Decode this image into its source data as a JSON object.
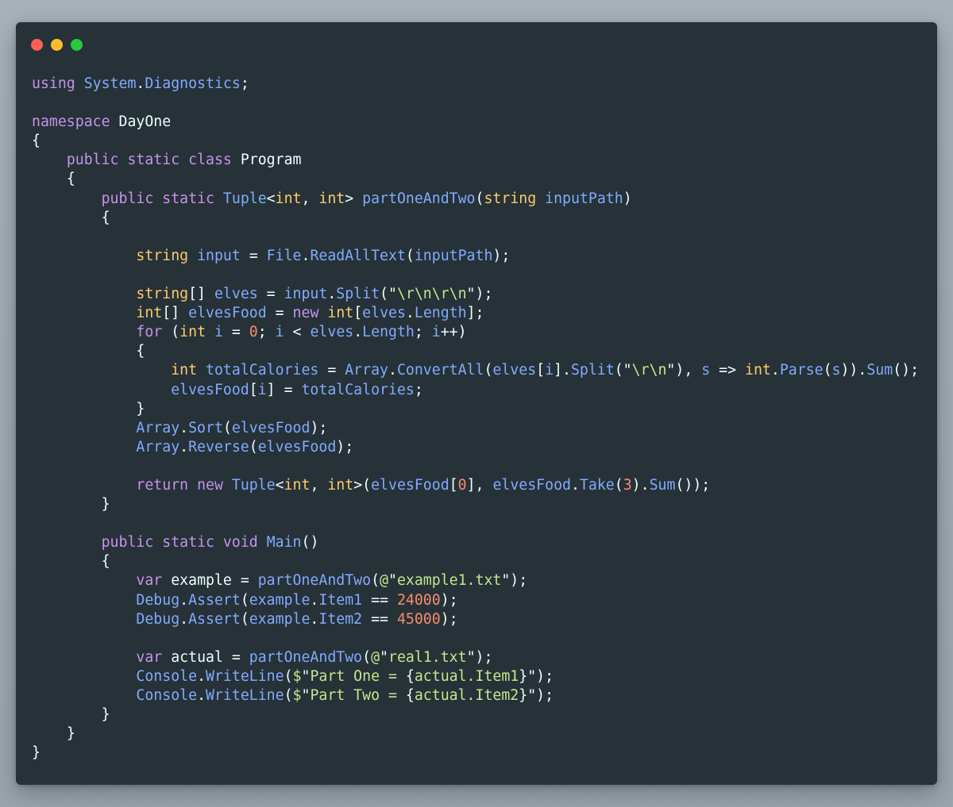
{
  "window": {
    "controls": {
      "close_color": "#ff5f56",
      "minimize_color": "#ffbd2e",
      "maximize_color": "#27c93f"
    }
  },
  "code": {
    "language": "csharp",
    "lines": [
      [
        [
          "kw",
          "using"
        ],
        [
          "plain",
          " "
        ],
        [
          "id",
          "System"
        ],
        [
          "punc",
          "."
        ],
        [
          "id",
          "Diagnostics"
        ],
        [
          "punc",
          ";"
        ]
      ],
      [],
      [
        [
          "kw",
          "namespace"
        ],
        [
          "plain",
          " DayOne"
        ]
      ],
      [
        [
          "punc",
          "{"
        ]
      ],
      [
        [
          "plain",
          "    "
        ],
        [
          "kw",
          "public"
        ],
        [
          "plain",
          " "
        ],
        [
          "kw",
          "static"
        ],
        [
          "plain",
          " "
        ],
        [
          "kw",
          "class"
        ],
        [
          "plain",
          " Program"
        ]
      ],
      [
        [
          "plain",
          "    "
        ],
        [
          "punc",
          "{"
        ]
      ],
      [
        [
          "plain",
          "        "
        ],
        [
          "kw",
          "public"
        ],
        [
          "plain",
          " "
        ],
        [
          "kw",
          "static"
        ],
        [
          "plain",
          " "
        ],
        [
          "id",
          "Tuple"
        ],
        [
          "punc",
          "<"
        ],
        [
          "type",
          "int"
        ],
        [
          "punc",
          ", "
        ],
        [
          "type",
          "int"
        ],
        [
          "punc",
          "> "
        ],
        [
          "fn",
          "partOneAndTwo"
        ],
        [
          "punc",
          "("
        ],
        [
          "type",
          "string"
        ],
        [
          "plain",
          " "
        ],
        [
          "id",
          "inputPath"
        ],
        [
          "punc",
          ")"
        ]
      ],
      [
        [
          "plain",
          "        "
        ],
        [
          "punc",
          "{"
        ]
      ],
      [],
      [
        [
          "plain",
          "            "
        ],
        [
          "type",
          "string"
        ],
        [
          "plain",
          " "
        ],
        [
          "id",
          "input"
        ],
        [
          "op",
          " = "
        ],
        [
          "id",
          "File"
        ],
        [
          "punc",
          "."
        ],
        [
          "fn",
          "ReadAllText"
        ],
        [
          "punc",
          "("
        ],
        [
          "id",
          "inputPath"
        ],
        [
          "punc",
          ");"
        ]
      ],
      [],
      [
        [
          "plain",
          "            "
        ],
        [
          "type",
          "string"
        ],
        [
          "punc",
          "[] "
        ],
        [
          "id",
          "elves"
        ],
        [
          "op",
          " = "
        ],
        [
          "id",
          "input"
        ],
        [
          "punc",
          "."
        ],
        [
          "fn",
          "Split"
        ],
        [
          "punc",
          "(\""
        ],
        [
          "str",
          "\\r\\n\\r\\n"
        ],
        [
          "punc",
          "\");"
        ]
      ],
      [
        [
          "plain",
          "            "
        ],
        [
          "type",
          "int"
        ],
        [
          "punc",
          "[] "
        ],
        [
          "id",
          "elvesFood"
        ],
        [
          "op",
          " = "
        ],
        [
          "kw",
          "new"
        ],
        [
          "plain",
          " "
        ],
        [
          "type",
          "int"
        ],
        [
          "punc",
          "["
        ],
        [
          "id",
          "elves"
        ],
        [
          "punc",
          "."
        ],
        [
          "id",
          "Length"
        ],
        [
          "punc",
          "];"
        ]
      ],
      [
        [
          "plain",
          "            "
        ],
        [
          "kw",
          "for"
        ],
        [
          "punc",
          " ("
        ],
        [
          "type",
          "int"
        ],
        [
          "plain",
          " "
        ],
        [
          "id",
          "i"
        ],
        [
          "op",
          " = "
        ],
        [
          "num",
          "0"
        ],
        [
          "punc",
          "; "
        ],
        [
          "id",
          "i"
        ],
        [
          "op",
          " < "
        ],
        [
          "id",
          "elves"
        ],
        [
          "punc",
          "."
        ],
        [
          "id",
          "Length"
        ],
        [
          "punc",
          "; "
        ],
        [
          "id",
          "i"
        ],
        [
          "op",
          "++"
        ],
        [
          "punc",
          ")"
        ]
      ],
      [
        [
          "plain",
          "            "
        ],
        [
          "punc",
          "{"
        ]
      ],
      [
        [
          "plain",
          "                "
        ],
        [
          "type",
          "int"
        ],
        [
          "plain",
          " "
        ],
        [
          "id",
          "totalCalories"
        ],
        [
          "op",
          " = "
        ],
        [
          "id",
          "Array"
        ],
        [
          "punc",
          "."
        ],
        [
          "fn",
          "ConvertAll"
        ],
        [
          "punc",
          "("
        ],
        [
          "id",
          "elves"
        ],
        [
          "punc",
          "["
        ],
        [
          "id",
          "i"
        ],
        [
          "punc",
          "]."
        ],
        [
          "fn",
          "Split"
        ],
        [
          "punc",
          "(\""
        ],
        [
          "str",
          "\\r\\n"
        ],
        [
          "punc",
          "\"), "
        ],
        [
          "id",
          "s"
        ],
        [
          "op",
          " => "
        ],
        [
          "type",
          "int"
        ],
        [
          "punc",
          "."
        ],
        [
          "fn",
          "Parse"
        ],
        [
          "punc",
          "("
        ],
        [
          "id",
          "s"
        ],
        [
          "punc",
          "))."
        ],
        [
          "fn",
          "Sum"
        ],
        [
          "punc",
          "();"
        ]
      ],
      [
        [
          "plain",
          "                "
        ],
        [
          "id",
          "elvesFood"
        ],
        [
          "punc",
          "["
        ],
        [
          "id",
          "i"
        ],
        [
          "punc",
          "]"
        ],
        [
          "op",
          " = "
        ],
        [
          "id",
          "totalCalories"
        ],
        [
          "punc",
          ";"
        ]
      ],
      [
        [
          "plain",
          "            "
        ],
        [
          "punc",
          "}"
        ]
      ],
      [
        [
          "plain",
          "            "
        ],
        [
          "id",
          "Array"
        ],
        [
          "punc",
          "."
        ],
        [
          "fn",
          "Sort"
        ],
        [
          "punc",
          "("
        ],
        [
          "id",
          "elvesFood"
        ],
        [
          "punc",
          ");"
        ]
      ],
      [
        [
          "plain",
          "            "
        ],
        [
          "id",
          "Array"
        ],
        [
          "punc",
          "."
        ],
        [
          "fn",
          "Reverse"
        ],
        [
          "punc",
          "("
        ],
        [
          "id",
          "elvesFood"
        ],
        [
          "punc",
          ");"
        ]
      ],
      [],
      [
        [
          "plain",
          "            "
        ],
        [
          "kw",
          "return"
        ],
        [
          "plain",
          " "
        ],
        [
          "kw",
          "new"
        ],
        [
          "plain",
          " "
        ],
        [
          "id",
          "Tuple"
        ],
        [
          "punc",
          "<"
        ],
        [
          "type",
          "int"
        ],
        [
          "punc",
          ", "
        ],
        [
          "type",
          "int"
        ],
        [
          "punc",
          ">("
        ],
        [
          "id",
          "elvesFood"
        ],
        [
          "punc",
          "["
        ],
        [
          "num",
          "0"
        ],
        [
          "punc",
          "], "
        ],
        [
          "id",
          "elvesFood"
        ],
        [
          "punc",
          "."
        ],
        [
          "fn",
          "Take"
        ],
        [
          "punc",
          "("
        ],
        [
          "num",
          "3"
        ],
        [
          "punc",
          ")."
        ],
        [
          "fn",
          "Sum"
        ],
        [
          "punc",
          "());"
        ]
      ],
      [
        [
          "plain",
          "        "
        ],
        [
          "punc",
          "}"
        ]
      ],
      [],
      [
        [
          "plain",
          "        "
        ],
        [
          "kw",
          "public"
        ],
        [
          "plain",
          " "
        ],
        [
          "kw",
          "static"
        ],
        [
          "plain",
          " "
        ],
        [
          "kw",
          "void"
        ],
        [
          "plain",
          " "
        ],
        [
          "fn",
          "Main"
        ],
        [
          "punc",
          "()"
        ]
      ],
      [
        [
          "plain",
          "        "
        ],
        [
          "punc",
          "{"
        ]
      ],
      [
        [
          "plain",
          "            "
        ],
        [
          "kw",
          "var"
        ],
        [
          "plain",
          " example"
        ],
        [
          "op",
          " = "
        ],
        [
          "fn",
          "partOneAndTwo"
        ],
        [
          "punc",
          "("
        ],
        [
          "str",
          "@"
        ],
        [
          "punc",
          "\""
        ],
        [
          "str",
          "example1.txt"
        ],
        [
          "punc",
          "\");"
        ]
      ],
      [
        [
          "plain",
          "            "
        ],
        [
          "id",
          "Debug"
        ],
        [
          "punc",
          "."
        ],
        [
          "fn",
          "Assert"
        ],
        [
          "punc",
          "("
        ],
        [
          "id",
          "example"
        ],
        [
          "punc",
          "."
        ],
        [
          "id",
          "Item1"
        ],
        [
          "op",
          " == "
        ],
        [
          "num",
          "24000"
        ],
        [
          "punc",
          ");"
        ]
      ],
      [
        [
          "plain",
          "            "
        ],
        [
          "id",
          "Debug"
        ],
        [
          "punc",
          "."
        ],
        [
          "fn",
          "Assert"
        ],
        [
          "punc",
          "("
        ],
        [
          "id",
          "example"
        ],
        [
          "punc",
          "."
        ],
        [
          "id",
          "Item2"
        ],
        [
          "op",
          " == "
        ],
        [
          "num",
          "45000"
        ],
        [
          "punc",
          ");"
        ]
      ],
      [],
      [
        [
          "plain",
          "            "
        ],
        [
          "kw",
          "var"
        ],
        [
          "plain",
          " actual"
        ],
        [
          "op",
          " = "
        ],
        [
          "fn",
          "partOneAndTwo"
        ],
        [
          "punc",
          "("
        ],
        [
          "str",
          "@"
        ],
        [
          "punc",
          "\""
        ],
        [
          "str",
          "real1.txt"
        ],
        [
          "punc",
          "\");"
        ]
      ],
      [
        [
          "plain",
          "            "
        ],
        [
          "id",
          "Console"
        ],
        [
          "punc",
          "."
        ],
        [
          "fn",
          "WriteLine"
        ],
        [
          "punc",
          "("
        ],
        [
          "str",
          "$"
        ],
        [
          "punc",
          "\""
        ],
        [
          "str",
          "Part One = "
        ],
        [
          "punc",
          "{"
        ],
        [
          "str",
          "actual.Item1"
        ],
        [
          "punc",
          "}\");"
        ]
      ],
      [
        [
          "plain",
          "            "
        ],
        [
          "id",
          "Console"
        ],
        [
          "punc",
          "."
        ],
        [
          "fn",
          "WriteLine"
        ],
        [
          "punc",
          "("
        ],
        [
          "str",
          "$"
        ],
        [
          "punc",
          "\""
        ],
        [
          "str",
          "Part Two = "
        ],
        [
          "punc",
          "{"
        ],
        [
          "str",
          "actual.Item2"
        ],
        [
          "punc",
          "}\");"
        ]
      ],
      [
        [
          "plain",
          "        "
        ],
        [
          "punc",
          "}"
        ]
      ],
      [
        [
          "plain",
          "    "
        ],
        [
          "punc",
          "}"
        ]
      ],
      [
        [
          "punc",
          "}"
        ]
      ]
    ]
  }
}
